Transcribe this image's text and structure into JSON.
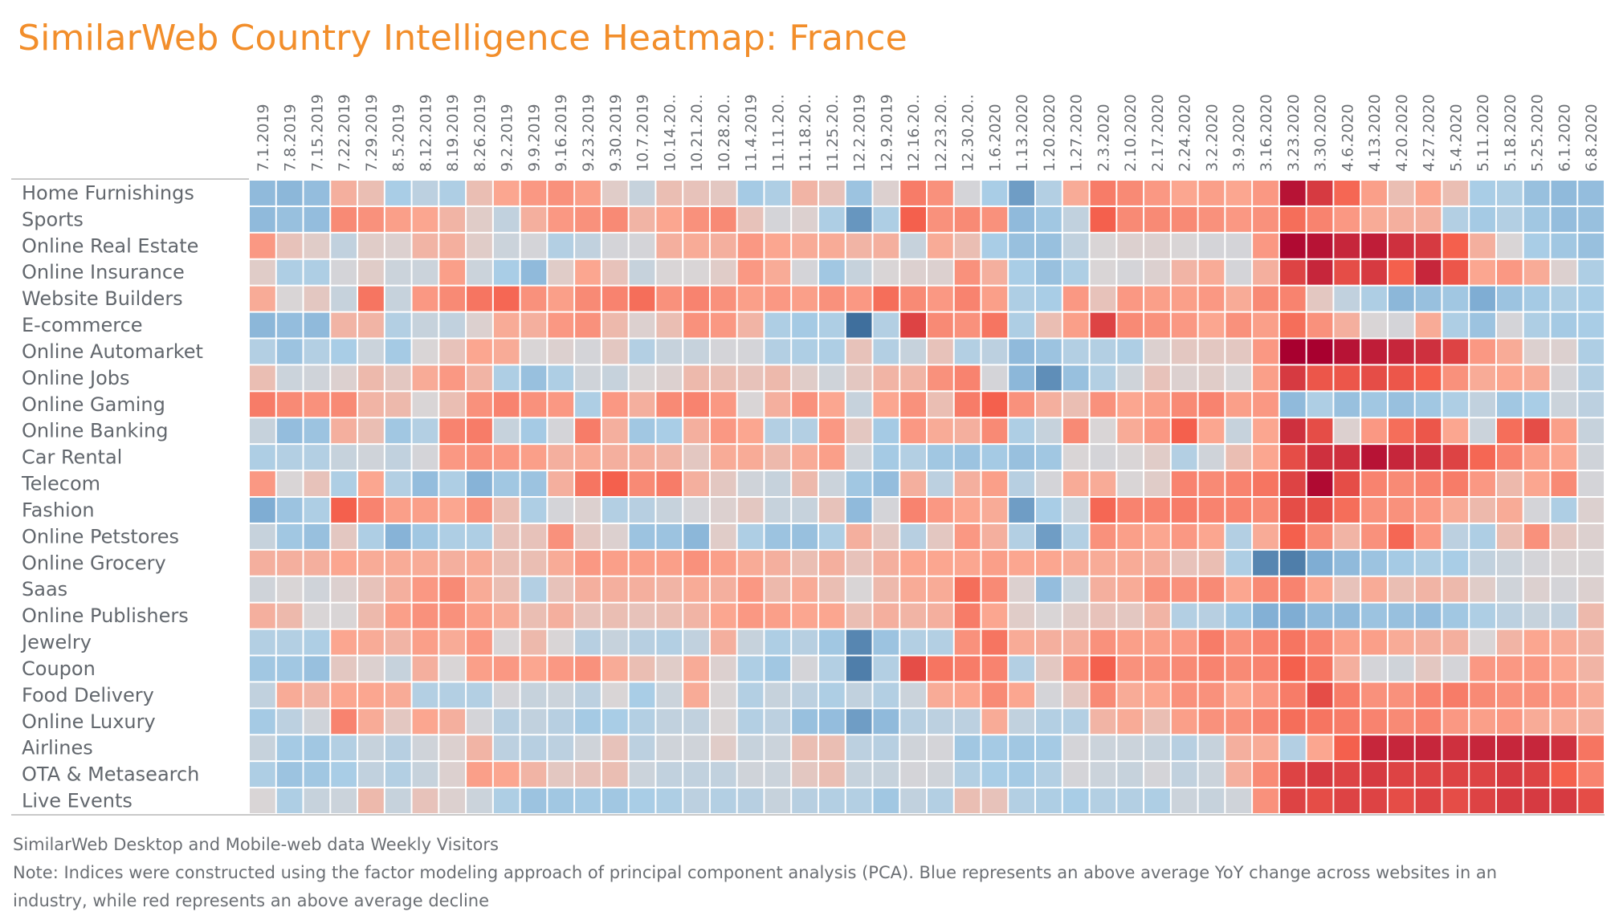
{
  "title": "SimilarWeb Country Intelligence Heatmap: France",
  "footer": {
    "source": "SimilarWeb Desktop and Mobile-web data Weekly Visitors",
    "note_line1": "Note: Indices were constructed using the factor modeling approach of principal component analysis (PCA). Blue represents an above average YoY change across websites in an",
    "note_line2": "industry, while red represents an above average decline"
  },
  "colors": {
    "title": "#f28e2b",
    "blue_max": "#2f5f8f",
    "neutral": "#d9d5d6",
    "red_max": "#a8002f"
  },
  "chart_data": {
    "type": "heatmap",
    "title": "SimilarWeb Country Intelligence Heatmap: France",
    "xlabel": "",
    "ylabel": "",
    "value_scale": "diverging index: positive = blue (above average YoY change), negative = red (above average decline)",
    "value_range": [
      -3,
      3
    ],
    "x": [
      "7.1.2019",
      "7.8.2019",
      "7.15.2019",
      "7.22.2019",
      "7.29.2019",
      "8.5.2019",
      "8.12.2019",
      "8.19.2019",
      "8.26.2019",
      "9.2.2019",
      "9.9.2019",
      "9.16.2019",
      "9.23.2019",
      "9.30.2019",
      "10.7.2019",
      "10.14.20..",
      "10.21.20..",
      "10.28.20..",
      "11.4.2019",
      "11.11.20..",
      "11.18.20..",
      "11.25.20..",
      "12.2.2019",
      "12.9.2019",
      "12.16.20..",
      "12.23.20..",
      "12.30.20..",
      "1.6.2020",
      "1.13.2020",
      "1.20.2020",
      "1.27.2020",
      "2.3.2020",
      "2.10.2020",
      "2.17.2020",
      "2.24.2020",
      "3.2.2020",
      "3.9.2020",
      "3.16.2020",
      "3.23.2020",
      "3.30.2020",
      "4.6.2020",
      "4.13.2020",
      "4.20.2020",
      "4.27.2020",
      "5.4.2020",
      "5.11.2020",
      "5.18.2020",
      "5.25.2020",
      "6.1.2020",
      "6.8.2020"
    ],
    "y": [
      "Home Furnishings",
      "Sports",
      "Online Real Estate",
      "Online Insurance",
      "Website Builders",
      "E-commerce",
      "Online Automarket",
      "Online Jobs",
      "Online Gaming",
      "Online Banking",
      "Car Rental",
      "Telecom",
      "Fashion",
      "Online Petstores",
      "Online Grocery",
      "Saas",
      "Online Publishers",
      "Jewelry",
      "Coupon",
      "Food Delivery",
      "Online Luxury",
      "Airlines",
      "OTA & Metasearch",
      "Live Events"
    ],
    "values": [
      [
        1.6,
        1.7,
        1.5,
        -0.8,
        -0.5,
        1.0,
        0.6,
        0.9,
        -0.5,
        -1.0,
        -1.2,
        -1.3,
        -1.1,
        -0.2,
        0.4,
        -0.5,
        -0.4,
        -0.3,
        1.1,
        0.9,
        -0.7,
        -0.4,
        1.3,
        -0.1,
        -1.6,
        -1.3,
        0.1,
        1.0,
        2.2,
        0.8,
        -0.9,
        -1.6,
        -1.4,
        -1.2,
        -1.0,
        -1.1,
        -1.0,
        -1.2,
        -2.8,
        -2.4,
        -1.9,
        -1.1,
        -0.5,
        -1.0,
        -0.5,
        1.0,
        0.9,
        1.4,
        1.6,
        1.5
      ],
      [
        1.6,
        1.4,
        1.5,
        -1.4,
        -1.3,
        -1.1,
        -1.0,
        -0.7,
        -0.2,
        0.5,
        -0.8,
        -1.2,
        -1.3,
        -1.4,
        -0.7,
        -1.0,
        -1.3,
        -1.4,
        -0.4,
        0.1,
        -0.1,
        0.9,
        2.3,
        0.9,
        -2.0,
        -1.3,
        -1.4,
        -1.3,
        1.6,
        1.2,
        0.5,
        -2.0,
        -1.4,
        -1.4,
        -1.4,
        -1.3,
        -1.2,
        -1.3,
        -1.8,
        -1.5,
        -1.2,
        -0.9,
        -0.8,
        -0.8,
        0.8,
        1.1,
        0.8,
        1.2,
        1.5,
        1.4
      ],
      [
        -1.2,
        -0.4,
        -0.2,
        0.5,
        -0.2,
        -0.1,
        -0.7,
        -0.8,
        -0.2,
        0.3,
        0.1,
        0.8,
        0.5,
        0.1,
        0.1,
        -0.8,
        -0.9,
        -0.8,
        -1.2,
        -1.0,
        -0.9,
        -0.9,
        -0.7,
        -0.8,
        0.4,
        -0.9,
        -0.5,
        1.0,
        1.4,
        1.4,
        0.5,
        0.0,
        -0.1,
        -0.1,
        0.0,
        0.1,
        0.1,
        -1.2,
        -2.9,
        -2.8,
        -2.6,
        -2.7,
        -2.5,
        -2.4,
        -2.0,
        -0.8,
        0.0,
        1.0,
        1.2,
        1.4
      ],
      [
        -0.2,
        0.9,
        0.9,
        0.1,
        -0.2,
        0.3,
        0.3,
        -1.1,
        0.3,
        1.0,
        1.6,
        -0.2,
        -1.0,
        -0.4,
        0.4,
        0.0,
        0.0,
        -0.2,
        -1.2,
        -0.9,
        0.1,
        1.2,
        0.4,
        0.0,
        -0.1,
        -0.1,
        -1.3,
        -0.8,
        1.0,
        1.4,
        0.9,
        0.0,
        0.1,
        -0.1,
        -0.7,
        -0.9,
        0.1,
        -0.8,
        -2.3,
        -2.6,
        -2.2,
        -2.4,
        -2.0,
        -2.6,
        -2.1,
        -1.0,
        -1.2,
        -0.9,
        -0.1,
        0.9
      ],
      [
        -0.9,
        0.0,
        -0.3,
        0.4,
        -1.7,
        0.4,
        -1.2,
        -1.4,
        -1.7,
        -1.9,
        -1.3,
        -1.1,
        -1.4,
        -1.5,
        -1.8,
        -1.3,
        -1.5,
        -1.3,
        -1.1,
        -1.2,
        -1.1,
        -1.3,
        -1.2,
        -1.8,
        -1.4,
        -1.2,
        -1.5,
        -1.1,
        0.9,
        1.0,
        -1.2,
        -0.4,
        -1.2,
        -1.1,
        -1.1,
        -1.2,
        -0.9,
        -1.4,
        -1.5,
        -0.3,
        0.5,
        0.9,
        1.7,
        1.4,
        1.2,
        2.0,
        1.3,
        1.1,
        0.9,
        1.0
      ],
      [
        1.7,
        1.5,
        1.6,
        -0.7,
        -0.7,
        0.8,
        0.4,
        0.5,
        -0.1,
        -0.9,
        -0.8,
        -1.2,
        -1.3,
        -0.6,
        -0.1,
        -0.5,
        -1.3,
        -1.2,
        -0.7,
        0.9,
        1.1,
        0.9,
        2.8,
        0.8,
        -2.3,
        -1.4,
        -1.3,
        -1.7,
        0.9,
        -0.5,
        -1.1,
        -2.3,
        -1.4,
        -1.3,
        -1.2,
        -1.0,
        -1.3,
        -1.1,
        -1.8,
        -1.3,
        -0.8,
        0.0,
        0.1,
        -0.9,
        0.9,
        1.3,
        0.1,
        0.9,
        1.1,
        1.0
      ],
      [
        0.8,
        1.3,
        0.8,
        1.0,
        0.3,
        1.1,
        0.0,
        -0.4,
        -1.0,
        -0.9,
        0.0,
        -0.1,
        0.1,
        -0.3,
        0.8,
        0.4,
        0.4,
        0.1,
        0.1,
        0.8,
        0.9,
        0.9,
        -0.4,
        0.8,
        0.4,
        -0.4,
        0.8,
        0.6,
        1.6,
        1.3,
        0.8,
        0.8,
        0.9,
        -0.1,
        -0.3,
        -0.3,
        -0.3,
        -1.2,
        -3.0,
        -3.0,
        -2.8,
        -2.7,
        -2.6,
        -2.5,
        -2.3,
        -1.2,
        -0.9,
        -0.1,
        -0.1,
        0.9
      ],
      [
        -0.5,
        0.3,
        0.2,
        -0.1,
        -0.6,
        -0.3,
        -0.9,
        -1.2,
        -0.7,
        0.9,
        1.4,
        0.9,
        0.2,
        0.4,
        0.0,
        -0.1,
        -0.6,
        -0.5,
        -0.4,
        -0.6,
        -0.2,
        0.2,
        -0.3,
        -0.7,
        -0.7,
        -1.3,
        -1.5,
        0.1,
        1.7,
        2.4,
        1.4,
        0.8,
        0.2,
        -0.4,
        -0.1,
        -0.2,
        0.0,
        -1.1,
        -2.4,
        -2.1,
        -2.1,
        -2.2,
        -2.1,
        -2.0,
        -1.3,
        -0.9,
        -1.0,
        -0.9,
        0.1,
        0.8
      ],
      [
        -1.6,
        -1.4,
        -1.3,
        -1.4,
        -0.7,
        -0.6,
        0.0,
        -0.5,
        -1.3,
        -1.5,
        -1.3,
        -1.2,
        0.9,
        -1.2,
        -0.8,
        -1.4,
        -1.5,
        -1.2,
        0.0,
        -0.8,
        -1.3,
        -1.0,
        0.4,
        -1.0,
        -1.3,
        -0.5,
        -1.6,
        -2.0,
        -1.3,
        -0.8,
        -0.5,
        -1.3,
        -1.0,
        -1.1,
        -1.4,
        -1.5,
        -1.1,
        -1.2,
        1.6,
        0.9,
        1.4,
        1.2,
        1.4,
        1.2,
        0.9,
        0.5,
        1.2,
        1.0,
        0.3,
        0.6
      ],
      [
        0.4,
        1.5,
        1.3,
        -0.8,
        -0.5,
        1.2,
        0.8,
        -1.5,
        -1.6,
        0.4,
        1.1,
        0.1,
        -1.6,
        -0.8,
        1.2,
        1.0,
        -0.8,
        -1.2,
        -1.0,
        0.8,
        0.8,
        -1.2,
        -0.3,
        1.1,
        -1.2,
        -0.9,
        -0.8,
        -1.4,
        0.9,
        0.4,
        -1.4,
        0.0,
        -0.9,
        -1.2,
        -2.0,
        -1.0,
        0.4,
        -1.0,
        -2.5,
        -2.2,
        -0.1,
        -1.2,
        -1.8,
        -2.1,
        -1.0,
        0.3,
        -1.8,
        -2.2,
        -1.1,
        0.4
      ],
      [
        0.9,
        0.8,
        0.8,
        0.4,
        0.2,
        0.5,
        0.1,
        -1.2,
        -1.3,
        -1.2,
        -1.1,
        -0.8,
        -0.9,
        -0.8,
        -0.8,
        -0.7,
        -0.3,
        -0.9,
        -0.9,
        -0.6,
        -0.9,
        -1.1,
        0.2,
        1.1,
        0.8,
        1.2,
        1.3,
        1.1,
        1.4,
        1.2,
        0.0,
        0.1,
        0.0,
        -0.2,
        0.8,
        0.2,
        -0.5,
        -1.0,
        -2.2,
        -2.5,
        -2.5,
        -2.8,
        -2.6,
        -2.5,
        -2.3,
        -1.9,
        -1.5,
        -1.1,
        -1.0,
        0.2
      ],
      [
        -1.2,
        0.0,
        -0.4,
        0.9,
        -1.0,
        0.8,
        1.5,
        0.9,
        1.8,
        1.2,
        1.3,
        -0.8,
        -1.7,
        -2.0,
        -1.4,
        -1.6,
        -0.8,
        -0.3,
        0.2,
        0.4,
        -0.6,
        0.3,
        1.2,
        1.5,
        -0.8,
        0.6,
        -0.8,
        -1.1,
        0.7,
        0.1,
        -0.9,
        -0.9,
        0.0,
        -0.2,
        -1.5,
        -1.4,
        -1.5,
        -1.7,
        -2.3,
        -2.9,
        -2.2,
        -1.5,
        -1.4,
        -1.5,
        -1.6,
        -1.2,
        -0.6,
        -1.0,
        -1.4,
        0.1
      ],
      [
        2.0,
        1.3,
        0.9,
        -2.0,
        -1.5,
        -1.1,
        -1.1,
        -1.0,
        -1.3,
        -0.5,
        0.9,
        0.1,
        -0.1,
        0.8,
        0.7,
        0.4,
        0.1,
        -0.1,
        -0.3,
        0.4,
        0.4,
        -0.4,
        1.6,
        0.1,
        -1.5,
        -1.2,
        -1.0,
        -0.9,
        2.2,
        1.0,
        0.3,
        -1.9,
        -1.5,
        -1.5,
        -1.6,
        -1.5,
        -1.5,
        -1.4,
        -2.2,
        -2.2,
        -1.8,
        -1.3,
        -1.3,
        -1.2,
        -0.9,
        -0.6,
        -0.9,
        0.1,
        0.9,
        -0.1
      ],
      [
        0.4,
        1.2,
        1.4,
        -0.3,
        0.9,
        1.8,
        1.2,
        0.9,
        0.9,
        -0.4,
        -0.4,
        -1.3,
        -0.3,
        -0.1,
        1.3,
        1.3,
        1.7,
        -0.2,
        0.9,
        1.3,
        1.4,
        0.9,
        -0.8,
        -0.3,
        0.7,
        -0.3,
        -1.2,
        -0.8,
        0.8,
        2.2,
        0.8,
        -1.3,
        -1.1,
        -1.0,
        -1.2,
        -1.0,
        0.8,
        -0.9,
        -2.0,
        -1.4,
        -0.7,
        -1.3,
        -1.9,
        -1.2,
        0.6,
        0.9,
        -0.5,
        -1.3,
        -0.3,
        -0.1
      ],
      [
        -0.8,
        -0.8,
        -0.8,
        -1.0,
        -0.9,
        -0.9,
        -0.9,
        -0.8,
        -0.9,
        -0.5,
        -0.5,
        -0.9,
        -1.2,
        -1.1,
        -1.1,
        -1.1,
        -1.3,
        -1.1,
        -0.9,
        -0.8,
        -0.5,
        -0.8,
        -0.4,
        -0.8,
        -1.0,
        -1.0,
        -1.0,
        -1.1,
        -1.0,
        -1.0,
        -0.9,
        -0.9,
        -0.9,
        -0.8,
        -0.4,
        -0.5,
        0.9,
        2.5,
        2.6,
        2.0,
        1.6,
        1.3,
        1.1,
        0.9,
        1.0,
        0.5,
        0.3,
        0.1,
        0.0,
        0.0
      ],
      [
        0.2,
        0.0,
        0.2,
        -0.1,
        -0.4,
        -0.8,
        -1.2,
        -1.4,
        -0.9,
        -0.5,
        0.8,
        -0.4,
        -0.8,
        -0.8,
        -0.8,
        -0.7,
        -0.9,
        -0.8,
        -1.2,
        -0.6,
        -0.9,
        -0.5,
        0.0,
        -0.6,
        -0.9,
        -0.9,
        -1.8,
        -1.4,
        -0.1,
        1.5,
        0.3,
        -0.8,
        -0.9,
        -1.3,
        -1.3,
        -1.4,
        -1.0,
        -1.4,
        -1.5,
        -1.0,
        -0.4,
        -0.9,
        -0.5,
        -0.7,
        -0.6,
        -0.2,
        0.2,
        -0.1,
        0.1,
        -0.1
      ],
      [
        -0.8,
        -0.6,
        0.0,
        0.0,
        -0.6,
        -1.1,
        -1.3,
        -1.3,
        -1.1,
        -0.9,
        -0.5,
        -0.8,
        -0.4,
        -0.5,
        -0.4,
        -0.5,
        -0.7,
        -1.0,
        -1.2,
        -1.1,
        -1.0,
        -1.0,
        -0.5,
        -0.8,
        -0.7,
        -0.8,
        -1.6,
        -1.0,
        -0.2,
        0.0,
        -0.2,
        -0.4,
        -0.3,
        -0.7,
        0.8,
        0.7,
        1.2,
        1.9,
        2.0,
        1.6,
        1.6,
        1.3,
        1.4,
        1.5,
        1.2,
        0.9,
        0.6,
        0.4,
        0.5,
        -0.6
      ],
      [
        0.8,
        0.8,
        0.9,
        -1.0,
        -0.9,
        -0.7,
        -1.1,
        -0.9,
        -1.2,
        0.0,
        -0.6,
        0.0,
        0.7,
        0.4,
        0.7,
        0.8,
        0.5,
        -0.8,
        0.4,
        0.9,
        0.7,
        1.2,
        2.5,
        1.3,
        0.8,
        0.8,
        -1.3,
        -1.7,
        -0.9,
        -0.8,
        -0.8,
        -1.3,
        -1.1,
        -1.1,
        -1.2,
        -1.6,
        -1.3,
        -1.5,
        -1.7,
        -1.5,
        -1.1,
        -1.1,
        -0.9,
        -0.8,
        -0.8,
        0.0,
        -0.7,
        -1.0,
        -0.9,
        -0.7
      ],
      [
        1.2,
        1.2,
        1.4,
        -0.3,
        -0.1,
        0.4,
        -0.8,
        0.0,
        -1.1,
        -1.2,
        -1.0,
        -1.2,
        -1.3,
        -0.9,
        -0.5,
        -0.2,
        -0.9,
        -0.1,
        0.9,
        1.2,
        0.1,
        0.8,
        2.6,
        0.8,
        -2.2,
        -1.7,
        -1.6,
        -1.5,
        0.8,
        -0.3,
        -1.3,
        -2.0,
        -1.3,
        -1.3,
        -1.4,
        -1.5,
        -1.4,
        -1.5,
        -2.0,
        -1.7,
        -0.8,
        0.1,
        0.2,
        -0.3,
        0.1,
        -1.2,
        -1.2,
        -1.2,
        -1.0,
        -0.7
      ],
      [
        0.5,
        -0.9,
        -0.7,
        -1.0,
        -1.0,
        -0.9,
        0.8,
        0.8,
        0.8,
        0.1,
        0.4,
        0.3,
        0.6,
        0.0,
        1.0,
        0.3,
        -0.9,
        0.0,
        0.8,
        0.4,
        0.6,
        0.9,
        0.5,
        0.8,
        0.3,
        -0.9,
        -1.0,
        -1.4,
        -1.0,
        0.1,
        -0.3,
        -1.4,
        -0.9,
        -1.0,
        -1.3,
        -1.3,
        -1.0,
        -1.2,
        -1.6,
        -2.2,
        -1.6,
        -1.3,
        -1.3,
        -1.5,
        -1.6,
        -1.4,
        -1.3,
        -1.3,
        -1.2,
        -0.9
      ],
      [
        1.1,
        0.6,
        0.2,
        -1.5,
        -0.9,
        -0.3,
        -1.0,
        -0.8,
        0.1,
        0.7,
        0.5,
        0.7,
        1.1,
        1.0,
        0.8,
        0.5,
        0.5,
        0.0,
        0.8,
        0.6,
        1.4,
        1.5,
        2.2,
        1.6,
        0.7,
        0.6,
        0.6,
        -0.9,
        0.5,
        0.8,
        0.8,
        -0.7,
        -0.9,
        -0.5,
        -1.1,
        -1.3,
        -1.3,
        -1.5,
        -1.8,
        -1.7,
        -1.6,
        -1.5,
        -1.4,
        -1.5,
        -1.2,
        -1.1,
        -1.2,
        -0.9,
        -0.9,
        -0.8
      ],
      [
        0.4,
        1.1,
        1.2,
        0.8,
        0.4,
        0.7,
        0.2,
        -0.1,
        -0.7,
        0.6,
        0.7,
        0.6,
        0.2,
        -0.4,
        0.6,
        0.2,
        0.2,
        -0.2,
        0.4,
        0.3,
        -0.5,
        -0.5,
        0.6,
        0.7,
        0.2,
        0.1,
        1.2,
        1.1,
        1.2,
        1.1,
        0.1,
        0.3,
        0.3,
        0.4,
        0.7,
        0.4,
        -0.8,
        -0.9,
        0.8,
        -1.0,
        -2.0,
        -2.6,
        -2.6,
        -2.6,
        -2.5,
        -2.6,
        -2.6,
        -2.6,
        -2.5,
        -1.7
      ],
      [
        0.9,
        1.3,
        1.2,
        1.0,
        0.5,
        0.8,
        0.4,
        -0.1,
        -1.1,
        -1.0,
        -0.7,
        -0.3,
        -0.4,
        -0.5,
        0.3,
        0.5,
        0.5,
        0.5,
        0.2,
        0.3,
        -0.3,
        -0.5,
        0.4,
        0.4,
        0.1,
        0.2,
        0.8,
        1.0,
        1.1,
        0.8,
        0.1,
        0.3,
        0.4,
        0.1,
        0.5,
        0.3,
        -0.8,
        -1.4,
        -2.3,
        -2.4,
        -2.3,
        -2.4,
        -2.3,
        -2.3,
        -2.3,
        -2.3,
        -2.4,
        -2.3,
        -2.0,
        -1.5
      ],
      [
        0.0,
        0.9,
        0.4,
        0.3,
        -0.6,
        0.4,
        -0.4,
        -0.1,
        0.3,
        0.9,
        1.3,
        1.2,
        1.1,
        1.2,
        1.0,
        0.9,
        0.6,
        0.8,
        0.7,
        0.4,
        0.7,
        0.8,
        0.8,
        1.2,
        0.5,
        0.8,
        -0.5,
        -0.4,
        0.8,
        0.9,
        1.0,
        0.8,
        0.8,
        0.9,
        0.3,
        0.4,
        0.2,
        -1.3,
        -2.3,
        -2.2,
        -2.3,
        -2.3,
        -2.2,
        -2.3,
        -2.2,
        -2.3,
        -2.4,
        -2.4,
        -2.4,
        -2.2
      ]
    ]
  }
}
